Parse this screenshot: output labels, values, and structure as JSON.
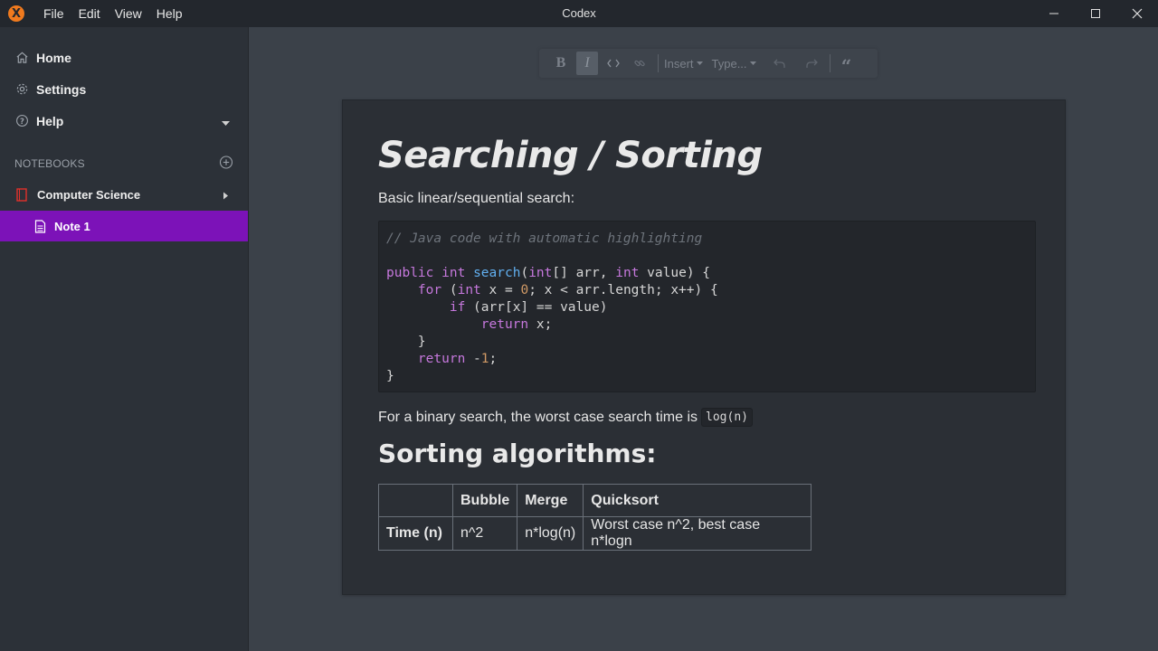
{
  "window": {
    "title": "Codex",
    "logo_glyph": "X",
    "menu": [
      "File",
      "Edit",
      "View",
      "Help"
    ]
  },
  "sidebar": {
    "nav": [
      {
        "label": "Home",
        "icon": "home-icon"
      },
      {
        "label": "Settings",
        "icon": "gear-icon"
      },
      {
        "label": "Help",
        "icon": "question-circle-icon"
      }
    ],
    "section_label": "NOTEBOOKS",
    "notebook": {
      "label": "Computer Science",
      "icon": "notebook-icon",
      "color": "#e0312b"
    },
    "note": {
      "label": "Note 1",
      "icon": "document-icon"
    },
    "accent": "#7c12b8"
  },
  "toolbar": {
    "bold": "B",
    "italic": "I",
    "insert_label": "Insert",
    "type_label": "Type...",
    "quote_glyph": "“"
  },
  "document": {
    "title": "Searching / Sorting",
    "para1": "Basic linear/sequential search:",
    "code_comment": "// Java code with automatic highlighting",
    "para2_text": "For a binary search, the worst case search time is",
    "para2_code": "log(n)",
    "heading2": "Sorting algorithms:",
    "table": {
      "headers": [
        "",
        "Bubble",
        "Merge",
        "Quicksort"
      ],
      "row": [
        "Time (n)",
        "n^2",
        "n*log(n)",
        "Worst case n^2, best case n*logn"
      ]
    }
  }
}
